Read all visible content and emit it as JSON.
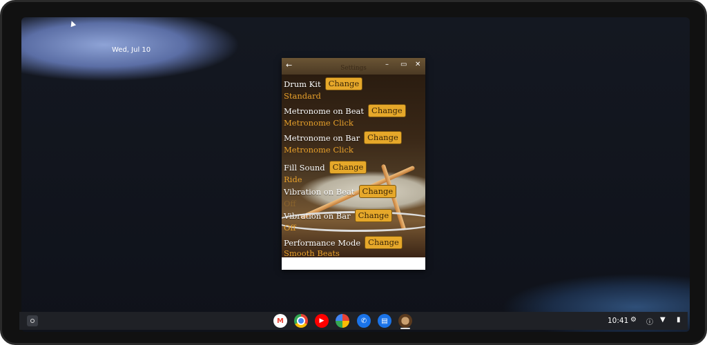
{
  "desktop": {
    "date": "Wed, Jul 10"
  },
  "window": {
    "title": "Settings",
    "back_icon": "arrow-left-icon",
    "minimize_glyph": "–",
    "maximize_glyph": "▭",
    "close_glyph": "✕"
  },
  "settings": [
    {
      "label": "Drum Kit",
      "button": "Change",
      "value": "Standard"
    },
    {
      "label": "Metronome on Beat",
      "button": "Change",
      "value": "Metronome Click"
    },
    {
      "label": "Metronome on Bar",
      "button": "Change",
      "value": "Metronome Click"
    },
    {
      "label": "Fill Sound",
      "button": "Change",
      "value": "Ride"
    },
    {
      "label": "Vibration on Beat",
      "button": "Change",
      "value": "Off"
    },
    {
      "label": "Vibration on Bar",
      "button": "Change",
      "value": "Off"
    },
    {
      "label": "Performance Mode",
      "button": "Change",
      "value": "Smooth Beats"
    }
  ],
  "shelf": {
    "apps": [
      {
        "name": "gmail-icon",
        "glyph": "M",
        "color": "#ffffff"
      },
      {
        "name": "chrome-icon",
        "glyph": "",
        "color": "#4285f4"
      },
      {
        "name": "youtube-icon",
        "glyph": "▶",
        "color": "#ff0000"
      },
      {
        "name": "photos-icon",
        "glyph": "✿",
        "color": "#fbbc05"
      },
      {
        "name": "phone-icon",
        "glyph": "✆",
        "color": "#1a73e8"
      },
      {
        "name": "messages-icon",
        "glyph": "▤",
        "color": "#1a73e8"
      },
      {
        "name": "drum-app-icon",
        "glyph": "",
        "color": "#6b4a2a"
      }
    ],
    "time": "10:41"
  },
  "colors": {
    "accent_button": "#e6a82a",
    "value_text": "#e8a12b"
  }
}
